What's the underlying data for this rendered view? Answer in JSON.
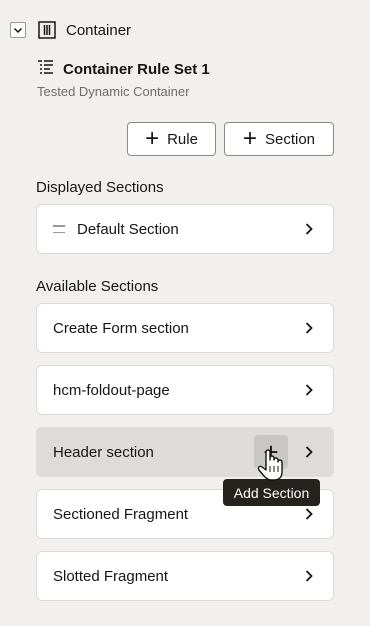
{
  "tree": {
    "container_label": "Container",
    "ruleset_title": "Container Rule Set 1",
    "ruleset_subtitle": "Tested Dynamic Container"
  },
  "toolbar": {
    "rule_label": "Rule",
    "section_label": "Section"
  },
  "displayed": {
    "heading": "Displayed Sections",
    "items": [
      {
        "label": "Default Section"
      }
    ]
  },
  "available": {
    "heading": "Available Sections",
    "items": [
      {
        "label": "Create Form section"
      },
      {
        "label": "hcm-foldout-page"
      },
      {
        "label": "Header section"
      },
      {
        "label": "Sectioned Fragment"
      },
      {
        "label": "Slotted Fragment"
      }
    ]
  },
  "tooltip": {
    "text": "Add Section"
  },
  "icons": {
    "expand": "chevron-down-icon",
    "container": "container-columns-icon",
    "ruleset": "list-rules-icon",
    "add": "plus-icon",
    "navigate": "chevron-right-icon",
    "drag": "drag-handle-icon",
    "cursor": "hand-pointer-icon"
  },
  "colors": {
    "background": "#f1f0ee",
    "card": "#ffffff",
    "card_hover": "#dedcd9",
    "tooltip_bg": "#26231f"
  }
}
